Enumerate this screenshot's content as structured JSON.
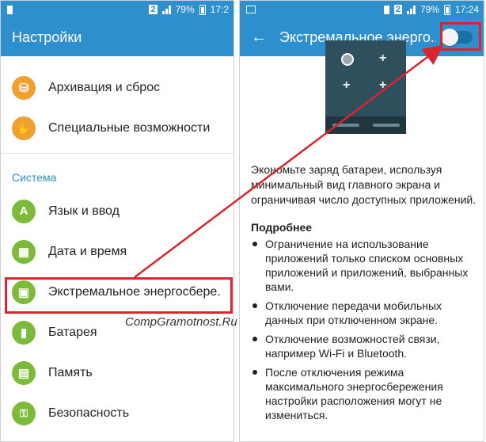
{
  "left": {
    "status": {
      "battery": "79%",
      "time": "17:2"
    },
    "appbar_title": "Настройки",
    "items_top": [
      {
        "label": "Архивация и сброс",
        "icon": "backup-icon"
      },
      {
        "label": "Специальные возможности",
        "icon": "hand-icon"
      }
    ],
    "section_title": "Система",
    "items_system": [
      {
        "label": "Язык и ввод",
        "icon": "language-icon",
        "glyph": "A"
      },
      {
        "label": "Дата и время",
        "icon": "calendar-icon",
        "glyph": "▦"
      },
      {
        "label": "Экстремальное энергосбере.",
        "icon": "power-saving-icon",
        "glyph": "▣"
      },
      {
        "label": "Батарея",
        "icon": "battery-icon",
        "glyph": "▮"
      },
      {
        "label": "Память",
        "icon": "storage-icon",
        "glyph": "▤"
      },
      {
        "label": "Безопасность",
        "icon": "lock-icon",
        "glyph": "🔒"
      }
    ]
  },
  "right": {
    "status": {
      "battery": "79%",
      "time": "17:24"
    },
    "appbar_title": "Экстремальное энерго...",
    "description": "Экономьте заряд батареи, используя минимальный вид главного экрана и ограничивая число доступных приложений.",
    "more_title": "Подробнее",
    "bullets": [
      "Ограничение на использование приложений только списком основных приложений и приложений, выбранных вами.",
      "Отключение передачи мобильных данных при отключенном экране.",
      "Отключение возможностей связи, например Wi-Fi и Bluetooth.",
      "После отключения режима максимального энергосбережения настройки расположения могут не измениться."
    ]
  },
  "watermark": "CompGramotnost.Ru",
  "colors": {
    "accent": "#2d8fcd",
    "highlight": "#d9252e"
  }
}
